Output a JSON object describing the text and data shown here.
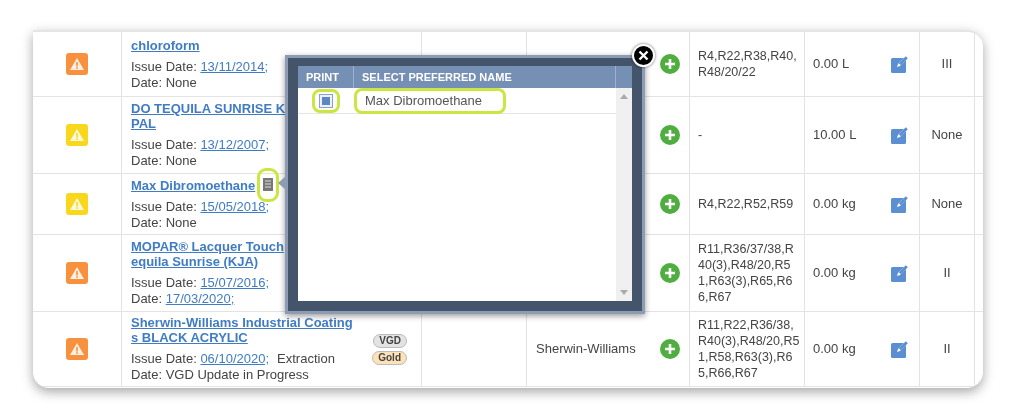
{
  "rows": [
    {
      "color": "#f7913d",
      "name_lines": [
        "chloroform"
      ],
      "issue_label": "Issue Date:",
      "issue_date": "13/11/2014;",
      "second_label": "Date:",
      "second_value": "None",
      "badges": [],
      "risk": "R4,R22,R38,R40,R48/20/22",
      "quantity": "0.00 L",
      "class": "III"
    },
    {
      "color": "#f9d71c",
      "name_lines": [
        "DO TEQUILA SUNRISE K",
        "PAL"
      ],
      "issue_label": "Issue Date:",
      "issue_date": "13/12/2007;",
      "second_label": "Date:",
      "second_value": "None",
      "badges": [],
      "risk": "-",
      "quantity": "10.00 L",
      "class": "None"
    },
    {
      "color": "#f9d71c",
      "name_lines": [
        "Max Dibromoethane"
      ],
      "doc_icon": {
        "highlighted": true
      },
      "issue_label": "Issue Date:",
      "issue_date": "15/05/2018;",
      "second_label": "Date:",
      "second_value": "None",
      "badges": [],
      "risk": "R4,R22,R52,R59",
      "quantity": "0.00 kg",
      "class": "None"
    },
    {
      "color": "#f7913d",
      "name_lines": [
        "MOPAR® Lacquer Touch",
        "equila Sunrise (KJA)"
      ],
      "issue_label": "Issue Date:",
      "issue_date": "15/07/2016;",
      "second_label": "Date:",
      "second_link": "17/03/2020;",
      "badges": [],
      "risk": "R11,R36/37/38,R40(3),R48/20,R51,R63(3),R65,R66,R67",
      "quantity": "0.00 kg",
      "class": "II"
    },
    {
      "color": "#f7913d",
      "name_lines": [
        "Sherwin-Williams Industrial Coating",
        "s BLACK ACRYLIC"
      ],
      "issue_label": "Issue Date:",
      "issue_date": "06/10/2020;",
      "extraction": "Extraction",
      "second_label": "Date:",
      "second_value": "VGD Update in Progress",
      "badges": [
        {
          "label": "VGD",
          "color": "#e3e3e3"
        },
        {
          "label": "Gold",
          "color": "#fde2b8"
        }
      ],
      "supplier": "Sherwin-Williams",
      "risk": "R11,R22,R36/38,R40(3),R48/20,R51,R58,R63(3),R65,R66,R67",
      "quantity": "0.00 kg",
      "class": "II"
    }
  ],
  "popup": {
    "columns": [
      "PRINT",
      "SELECT PREFERRED NAME"
    ],
    "rows": [
      {
        "checked": true,
        "highlighted": true,
        "name": "Max Dibromoethane"
      }
    ]
  }
}
